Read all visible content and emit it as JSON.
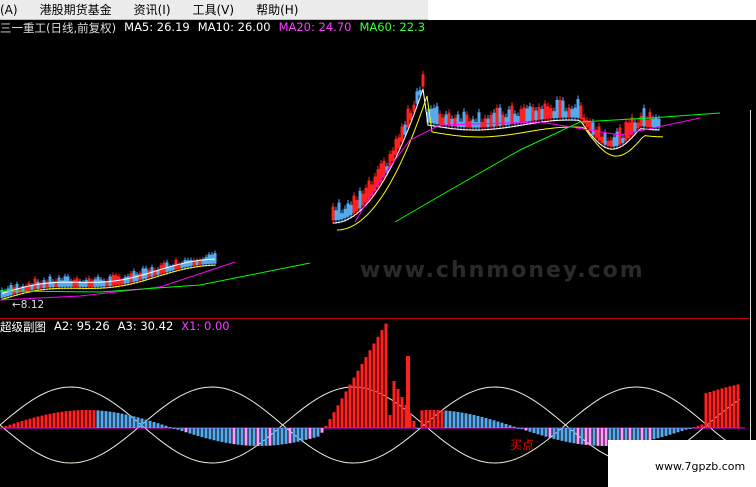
{
  "menu": {
    "items": [
      "(A)",
      "港股期货基金",
      "资讯(I)",
      "工具(V)",
      "帮助(H)"
    ]
  },
  "header": {
    "title": "三一重工(日线,前复权)",
    "ma5": "MA5: 26.19",
    "ma10": "MA10: 26.00",
    "ma20": "MA20: 24.70",
    "ma60": "MA60: 22.3"
  },
  "sub": {
    "title": "超级副图",
    "a2": "A2: 95.26",
    "a3": "A3: 30.42",
    "x1": "X1: 0.00"
  },
  "labels": {
    "low_price": "←8.12",
    "buy_point": "买点",
    "site": "www.7gpzb.com",
    "ghost_watermark": "www.chnmoney.com"
  },
  "colors": {
    "ma5": "#ffffff",
    "ma10": "#ffff00",
    "ma20": "#ff00ff",
    "ma60": "#00ff00",
    "up": "#ff2020",
    "down": "#55aaee",
    "sub_title": "#ffffff",
    "x1": "#ff00ff"
  }
}
